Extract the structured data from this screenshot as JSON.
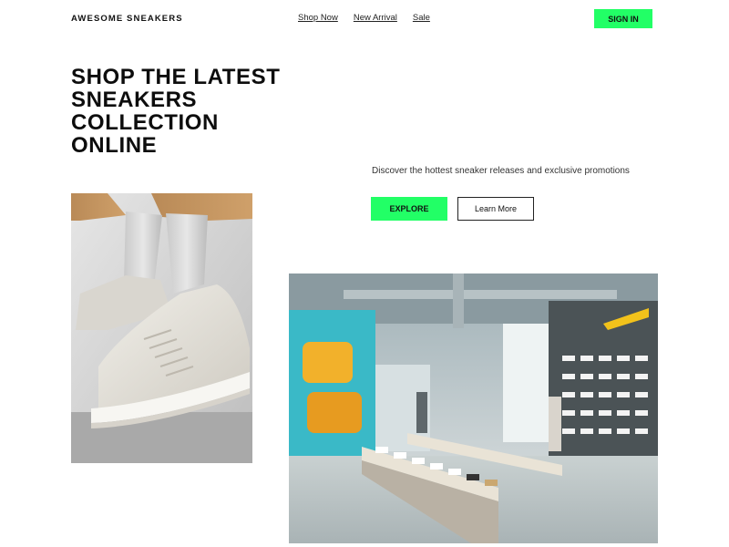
{
  "header": {
    "brand": "AWESOME SNEAKERS",
    "nav": [
      "Shop Now",
      "New Arrival",
      "Sale"
    ],
    "signin_label": "SIGN IN"
  },
  "hero": {
    "title": "SHOP THE LATEST SNEAKERS COLLECTION ONLINE",
    "subtitle": "Discover the hottest sneaker releases and exclusive promotions",
    "explore_label": "EXPLORE",
    "learn_more_label": "Learn More"
  },
  "images": {
    "shoe_photo": "sneaker-closeup-photo",
    "store_photo": "sneaker-store-interior-photo"
  },
  "colors": {
    "accent": "#22ff66",
    "text": "#111111",
    "background": "#ffffff"
  }
}
